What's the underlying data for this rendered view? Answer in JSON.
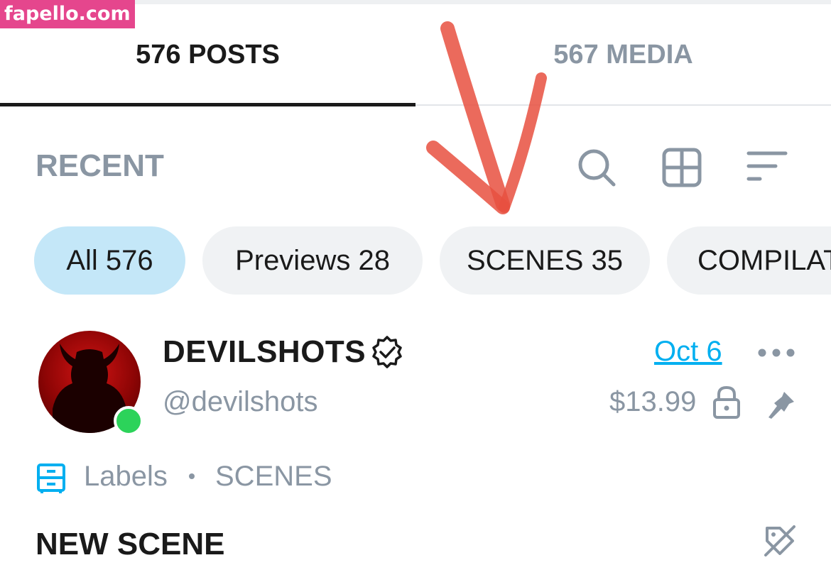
{
  "watermark": {
    "text": "fapello.com"
  },
  "tabs": [
    {
      "label": "576 POSTS",
      "active": true
    },
    {
      "label": "567 MEDIA",
      "active": false
    }
  ],
  "toolbar": {
    "section_label": "RECENT",
    "icons": [
      "search-icon",
      "grid-icon",
      "sort-icon"
    ]
  },
  "filter_chips": [
    {
      "label": "All 576",
      "active": true
    },
    {
      "label": "Previews 28",
      "active": false
    },
    {
      "label": "SCENES 35",
      "active": false
    },
    {
      "label": "COMPILAT",
      "active": false
    }
  ],
  "post": {
    "author_name": "DEVILSHOTS",
    "verified": true,
    "handle": "@devilshots",
    "date": "Oct 6",
    "price": "$13.99",
    "labels_title": "Labels",
    "labels_value": "SCENES",
    "title": "NEW SCENE",
    "online": true
  },
  "colors": {
    "accent": "#00aff0",
    "active_chip": "#c4e7f8",
    "chip": "#f0f2f4",
    "muted_text": "#8a96a3",
    "watermark_bg": "#e5468d",
    "online": "#2cd35a",
    "annotation_arrow": "#e8503f"
  }
}
